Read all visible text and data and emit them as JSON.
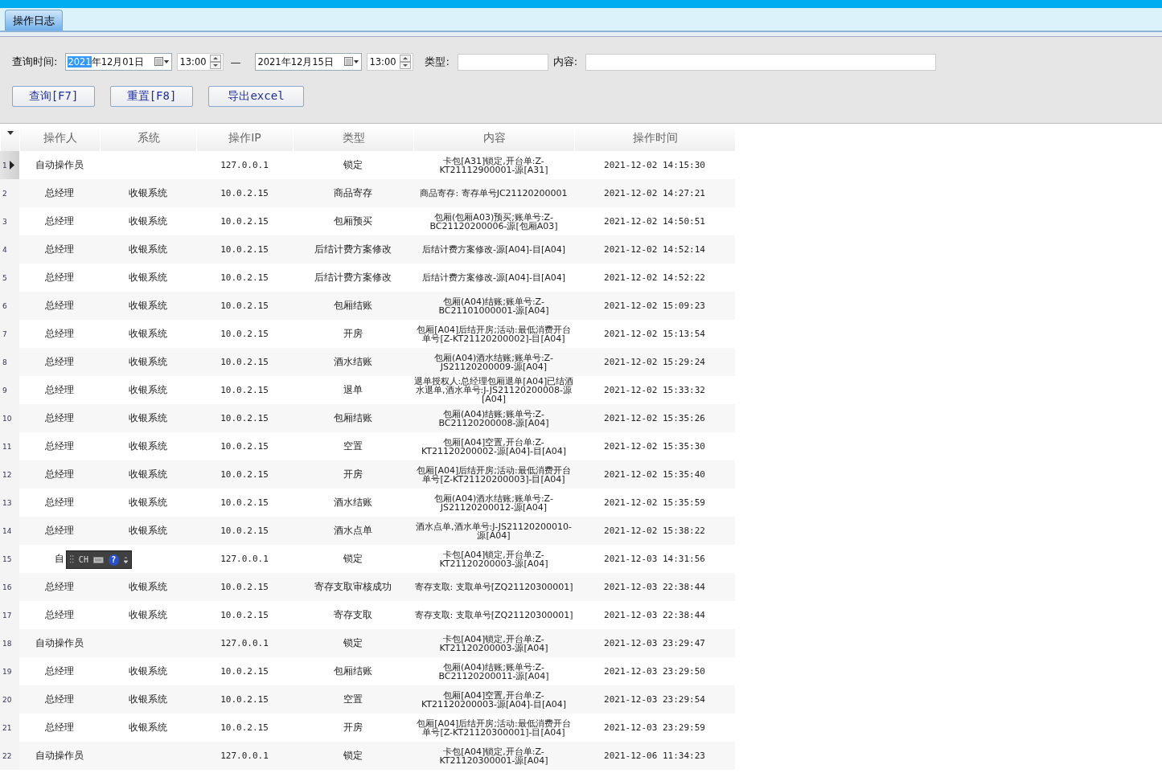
{
  "tabs": [
    {
      "label": "操作日志",
      "selected": true
    }
  ],
  "filter": {
    "time_label": "查询时间:",
    "date_from": {
      "highlighted": "2021",
      "value": "年12月01日"
    },
    "time_from": "13:00",
    "separator": "—",
    "date_to": {
      "value": "2021年12月15日"
    },
    "time_to": "13:00",
    "type_label": "类型:",
    "content_label": "内容:"
  },
  "buttons": [
    "查询[F7]",
    "重置[F8]",
    "导出excel"
  ],
  "table": {
    "columns": [
      "操作人",
      "系统",
      "操作IP",
      "类型",
      "内容",
      "操作时间"
    ],
    "rows": [
      {
        "no": "1",
        "selected": true,
        "cells": [
          "自动操作员",
          "",
          "127.0.0.1",
          "锁定",
          "卡包[A31]锁定,开台单:Z-KT21112900001-源[A31]",
          "2021-12-02 14:15:30"
        ]
      },
      {
        "no": "2",
        "selected": false,
        "cells": [
          "总经理",
          "收银系统",
          "10.0.2.15",
          "商品寄存",
          "商品寄存: 寄存单号JC21120200001",
          "2021-12-02 14:27:21"
        ]
      },
      {
        "no": "3",
        "selected": false,
        "cells": [
          "总经理",
          "收银系统",
          "10.0.2.15",
          "包厢预买",
          "包厢(包厢A03)预买;账单号:Z-BC21120200006-源[包厢A03]",
          "2021-12-02 14:50:51"
        ]
      },
      {
        "no": "4",
        "selected": false,
        "cells": [
          "总经理",
          "收银系统",
          "10.0.2.15",
          "后结计费方案修改",
          "后结计费方案修改-源[A04]-目[A04]",
          "2021-12-02 14:52:14"
        ]
      },
      {
        "no": "5",
        "selected": false,
        "cells": [
          "总经理",
          "收银系统",
          "10.0.2.15",
          "后结计费方案修改",
          "后结计费方案修改-源[A04]-目[A04]",
          "2021-12-02 14:52:22"
        ]
      },
      {
        "no": "6",
        "selected": false,
        "cells": [
          "总经理",
          "收银系统",
          "10.0.2.15",
          "包厢结账",
          "包厢(A04)结账;账单号:Z-BC21101000001-源[A04]",
          "2021-12-02 15:09:23"
        ]
      },
      {
        "no": "7",
        "selected": false,
        "cells": [
          "总经理",
          "收银系统",
          "10.0.2.15",
          "开房",
          "包厢[A04]后结开房;活动:最低消费开台单号[Z-KT21120200002]-目[A04]",
          "2021-12-02 15:13:54"
        ]
      },
      {
        "no": "8",
        "selected": false,
        "cells": [
          "总经理",
          "收银系统",
          "10.0.2.15",
          "酒水结账",
          "包厢(A04)酒水结账;账单号:Z-JS21120200009-源[A04]",
          "2021-12-02 15:29:24"
        ]
      },
      {
        "no": "9",
        "selected": false,
        "cells": [
          "总经理",
          "收银系统",
          "10.0.2.15",
          "退单",
          "退单授权人:总经理包厢退单[A04]已结酒水退单,酒水单号:J-JS21120200008-源[A04]",
          "2021-12-02 15:33:32"
        ]
      },
      {
        "no": "10",
        "selected": false,
        "cells": [
          "总经理",
          "收银系统",
          "10.0.2.15",
          "包厢结账",
          "包厢(A04)结账;账单号:Z-BC21120200008-源[A04]",
          "2021-12-02 15:35:26"
        ]
      },
      {
        "no": "11",
        "selected": false,
        "cells": [
          "总经理",
          "收银系统",
          "10.0.2.15",
          "空置",
          "包厢[A04]空置,开台单:Z-KT21120200002-源[A04]-目[A04]",
          "2021-12-02 15:35:30"
        ]
      },
      {
        "no": "12",
        "selected": false,
        "cells": [
          "总经理",
          "收银系统",
          "10.0.2.15",
          "开房",
          "包厢[A04]后结开房;活动:最低消费开台单号[Z-KT21120200003]-目[A04]",
          "2021-12-02 15:35:40"
        ]
      },
      {
        "no": "13",
        "selected": false,
        "cells": [
          "总经理",
          "收银系统",
          "10.0.2.15",
          "酒水结账",
          "包厢(A04)酒水结账;账单号:Z-JS21120200012-源[A04]",
          "2021-12-02 15:35:59"
        ]
      },
      {
        "no": "14",
        "selected": false,
        "cells": [
          "总经理",
          "收银系统",
          "10.0.2.15",
          "酒水点单",
          "酒水点单,酒水单号:J-JS21120200010-源[A04]",
          "2021-12-02 15:38:22"
        ]
      },
      {
        "no": "15",
        "selected": false,
        "cells": [
          "自",
          "",
          "127.0.0.1",
          "锁定",
          "卡包[A04]锁定,开台单:Z-KT21120200003-源[A04]",
          "2021-12-03 14:31:56"
        ]
      },
      {
        "no": "16",
        "selected": false,
        "cells": [
          "总经理",
          "收银系统",
          "10.0.2.15",
          "寄存支取审核成功",
          "寄存支取: 支取单号[ZQ21120300001]",
          "2021-12-03 22:38:44"
        ]
      },
      {
        "no": "17",
        "selected": false,
        "cells": [
          "总经理",
          "收银系统",
          "10.0.2.15",
          "寄存支取",
          "寄存支取: 支取单号[ZQ21120300001]",
          "2021-12-03 22:38:44"
        ]
      },
      {
        "no": "18",
        "selected": false,
        "cells": [
          "自动操作员",
          "",
          "127.0.0.1",
          "锁定",
          "卡包[A04]锁定,开台单:Z-KT21120200003-源[A04]",
          "2021-12-03 23:29:47"
        ]
      },
      {
        "no": "19",
        "selected": false,
        "cells": [
          "总经理",
          "收银系统",
          "10.0.2.15",
          "包厢结账",
          "包厢(A04)结账;账单号:Z-BC21120200011-源[A04]",
          "2021-12-03 23:29:50"
        ]
      },
      {
        "no": "20",
        "selected": false,
        "cells": [
          "总经理",
          "收银系统",
          "10.0.2.15",
          "空置",
          "包厢[A04]空置,开台单:Z-KT21120200003-源[A04]-目[A04]",
          "2021-12-03 23:29:54"
        ]
      },
      {
        "no": "21",
        "selected": false,
        "cells": [
          "总经理",
          "收银系统",
          "10.0.2.15",
          "开房",
          "包厢[A04]后结开房;活动:最低消费开台单号[Z-KT21120300001]-目[A04]",
          "2021-12-03 23:29:59"
        ]
      },
      {
        "no": "22",
        "selected": false,
        "cells": [
          "自动操作员",
          "",
          "127.0.0.1",
          "锁定",
          "卡包[A04]锁定,开台单:Z-KT21120300001-源[A04]",
          "2021-12-06 11:34:23"
        ]
      }
    ]
  },
  "ime": {
    "label": "CH",
    "help": "?"
  }
}
